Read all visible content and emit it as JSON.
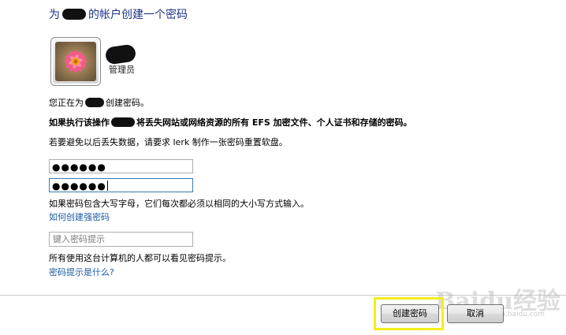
{
  "header": {
    "title_prefix": "为",
    "title_suffix": "的帐户创建一个密码"
  },
  "account": {
    "role": "管理员"
  },
  "messages": {
    "line1_prefix": "您正在为",
    "line1_suffix": "创建密码。",
    "line2_prefix": "如果执行该操作",
    "line2_suffix": "将丢失网站或网络资源的所有 EFS 加密文件、个人证书和存储的密码。",
    "line3": "若要避免以后丢失数据，请要求 lerk 制作一张密码重置软盘。"
  },
  "password": {
    "field1_value": "●●●●●●",
    "field2_value": "●●●●●●",
    "case_note": "如果密码包含大写字母，它们每次都必须以相同的大小写方式输入。",
    "strong_link": "如何创建强密码"
  },
  "hint": {
    "placeholder": "键入密码提示",
    "note": "所有使用这台计算机的人都可以看见密码提示。",
    "what_link": "密码提示是什么?"
  },
  "buttons": {
    "create": "创建密码",
    "cancel": "取消"
  },
  "watermark": {
    "main": "Baidu经验",
    "sub": "jingyan.baidu.com"
  },
  "colors": {
    "title": "#1e3287",
    "link": "#1b5aa5",
    "highlight": "#f3ee1c"
  },
  "icons": {
    "avatar": "flower-avatar-icon"
  }
}
